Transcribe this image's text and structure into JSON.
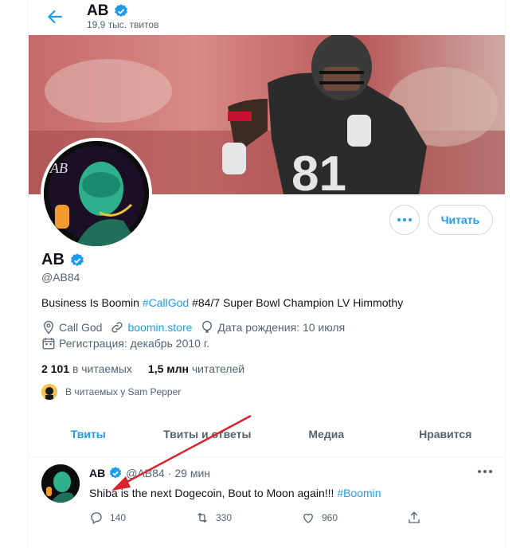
{
  "header": {
    "title": "AB",
    "tweet_count": "19,9 тыс. твитов"
  },
  "profile": {
    "name": "AB",
    "handle": "@AB84",
    "bio_text_1": "Business Is Boomin ",
    "bio_link": "#CallGod",
    "bio_text_2": " #84/7 Super Bowl Champion LV Himmothy",
    "location": "Call God",
    "website": "boomin.store",
    "birthday": "Дата рождения: 10 июля",
    "joined": "Регистрация: декабрь 2010 г.",
    "following_count": "2 101",
    "following_label": "в читаемых",
    "followers_count": "1,5 млн",
    "followers_label": "читателей",
    "followed_by": "В читаемых у Sam Pepper",
    "follow_button": "Читать",
    "banner_jersey_number": "81"
  },
  "tabs": [
    {
      "label": "Твиты",
      "active": true
    },
    {
      "label": "Твиты и ответы",
      "active": false
    },
    {
      "label": "Медиа",
      "active": false
    },
    {
      "label": "Нравится",
      "active": false
    }
  ],
  "tweet": {
    "author": "AB",
    "handle": "@AB84",
    "separator": "·",
    "time": "29 мин",
    "text": "Shiba is the next Dogecoin, Bout to Moon again!!! ",
    "hashtag": "#Boomin",
    "replies": "140",
    "retweets": "330",
    "likes": "960"
  },
  "colors": {
    "accent": "#1d9bf0",
    "annotation_arrow": "#d9232e",
    "text_secondary": "#536471"
  }
}
